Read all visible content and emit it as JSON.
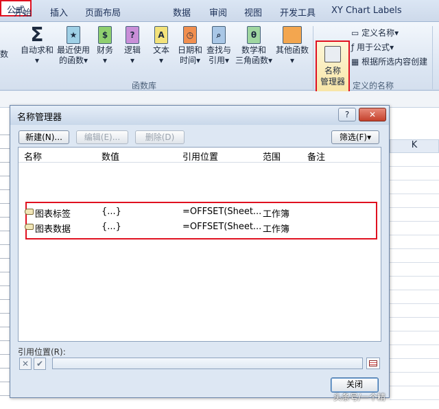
{
  "tabs": [
    "开始",
    "插入",
    "页面布局",
    "公式",
    "数据",
    "审阅",
    "视图",
    "开发工具",
    "XY Chart Labels"
  ],
  "ribbon": {
    "partial_left_label": "数",
    "autosum": "自动求和",
    "recent": [
      "最近使用",
      "的函数"
    ],
    "finance": "财务",
    "logic": "逻辑",
    "text": "文本",
    "datetime": [
      "日期和",
      "时间"
    ],
    "lookup": [
      "查找与",
      "引用"
    ],
    "math": [
      "数学和",
      "三角函数"
    ],
    "other": "其他函数",
    "lib_group": "函数库",
    "name_manager": [
      "名称",
      "管理器"
    ],
    "define_name": "定义名称",
    "use_in_formula": "用于公式",
    "create_from_selection": "根据所选内容创建",
    "defined_names_group": "定义的名称",
    "dropdown": "▾"
  },
  "sheet": {
    "col_k": "K"
  },
  "dialog": {
    "title": "名称管理器",
    "help": "?",
    "close_x": "✕",
    "new_btn": "新建(N)...",
    "edit_btn": "编辑(E)...",
    "delete_btn": "删除(D)",
    "filter_btn": "筛选(F)▾",
    "columns": [
      "名称",
      "数值",
      "引用位置",
      "范围",
      "备注"
    ],
    "rows": [
      {
        "name": "图表标签",
        "value": "{...}",
        "ref": "=OFFSET(Sheet...",
        "scope": "工作簿",
        "note": ""
      },
      {
        "name": "图表数据",
        "value": "{...}",
        "ref": "=OFFSET(Sheet...",
        "scope": "工作簿",
        "note": ""
      }
    ],
    "ref_label": "引用位置(R):",
    "cancel_sym": "✕",
    "ok_sym": "✔",
    "close_btn": "关闭"
  },
  "watermark": "头条号/一个精"
}
